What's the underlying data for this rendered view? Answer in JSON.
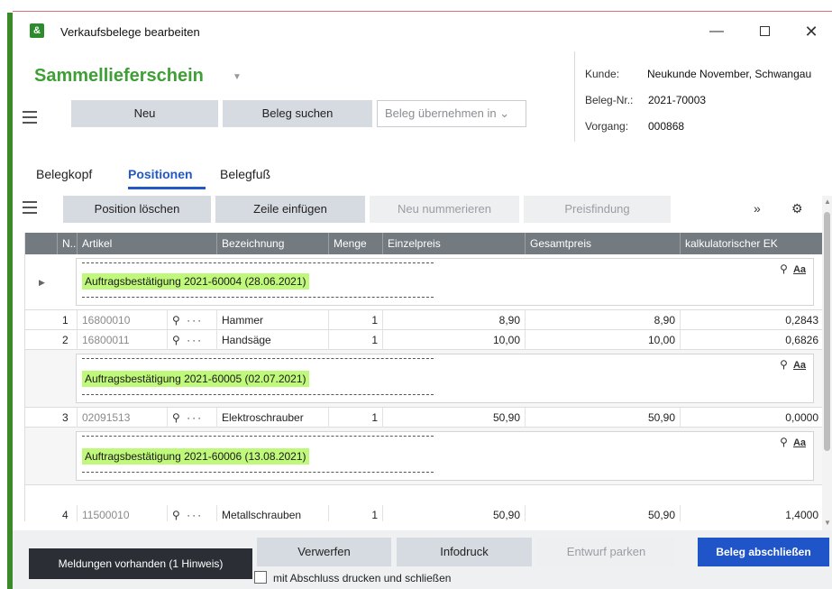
{
  "window": {
    "title": "Verkaufsbelege bearbeiten",
    "minimize": "—",
    "close": "✕"
  },
  "header": {
    "doc_type": "Sammellieferschein",
    "buttons": {
      "new": "Neu",
      "search": "Beleg suchen",
      "transfer": "Beleg übernehmen in ⌄"
    },
    "info": {
      "customer_label": "Kunde:",
      "customer_value": "Neukunde November, Schwangau",
      "doc_no_label": "Beleg-Nr.:",
      "doc_no_value": "2021-70003",
      "process_label": "Vorgang:",
      "process_value": "000868"
    }
  },
  "tabs": [
    "Belegkopf",
    "Positionen",
    "Belegfuß"
  ],
  "active_tab": "Positionen",
  "grid_toolbar": {
    "delete": "Position löschen",
    "insert": "Zeile einfügen",
    "renumber": "Neu nummerieren",
    "pricing": "Preisfindung"
  },
  "columns": [
    "N..",
    "Artikel",
    "Bezeichnung",
    "Menge",
    "Einzelpreis",
    "Gesamtpreis",
    "kalkulatorischer EK"
  ],
  "blocks": [
    {
      "text": "Auftragsbestätigung 2021-60004 (28.06.2021)"
    },
    {
      "text": "Auftragsbestätigung 2021-60005 (02.07.2021)"
    },
    {
      "text": "Auftragsbestätigung 2021-60006 (13.08.2021)"
    }
  ],
  "text_block_icons": {
    "aa": "Aa"
  },
  "rows": [
    {
      "n": "1",
      "artikel": "16800010",
      "bezeichnung": "Hammer",
      "menge": "1",
      "einzelpreis": "8,90",
      "gesamtpreis": "8,90",
      "ek": "0,2843"
    },
    {
      "n": "2",
      "artikel": "16800011",
      "bezeichnung": "Handsäge",
      "menge": "1",
      "einzelpreis": "10,00",
      "gesamtpreis": "10,00",
      "ek": "0,6826"
    },
    {
      "n": "3",
      "artikel": "02091513",
      "bezeichnung": "Elektroschrauber",
      "menge": "1",
      "einzelpreis": "50,90",
      "gesamtpreis": "50,90",
      "ek": "0,0000"
    },
    {
      "n": "4",
      "artikel": "11500010",
      "bezeichnung": "Metallschrauben",
      "menge": "1",
      "einzelpreis": "50,90",
      "gesamtpreis": "50,90",
      "ek": "1,4000"
    }
  ],
  "footer": {
    "messages": "Meldungen vorhanden (1 Hinweis)",
    "discard": "Verwerfen",
    "infoprint": "Infodruck",
    "park": "Entwurf parken",
    "finish": "Beleg abschließen",
    "print_checkbox_label": "mit Abschluss drucken und schließen"
  },
  "colors": {
    "accent_blue": "#1f55c8",
    "doc_type_green": "#3ea034",
    "highlight_green": "#bff87a",
    "header_gray": "#737a80"
  }
}
